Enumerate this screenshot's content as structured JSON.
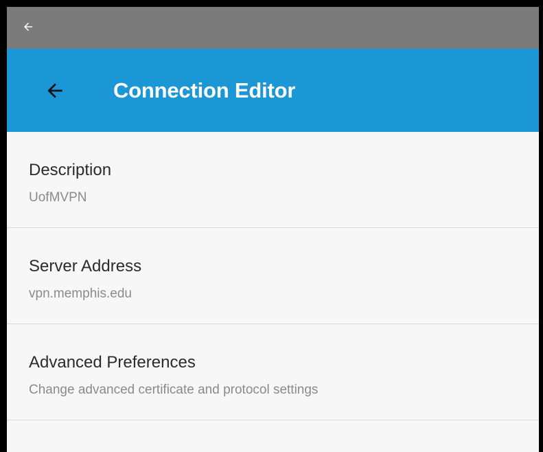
{
  "status_bar": {
    "icon": "back-arrow-icon"
  },
  "app_bar": {
    "back_icon": "back-arrow-icon",
    "title": "Connection Editor",
    "color": "#1c97d6"
  },
  "items": [
    {
      "title": "Description",
      "value": "UofMVPN"
    },
    {
      "title": "Server Address",
      "value": "vpn.memphis.edu"
    },
    {
      "title": "Advanced Preferences",
      "value": "Change advanced certificate and protocol settings"
    }
  ]
}
